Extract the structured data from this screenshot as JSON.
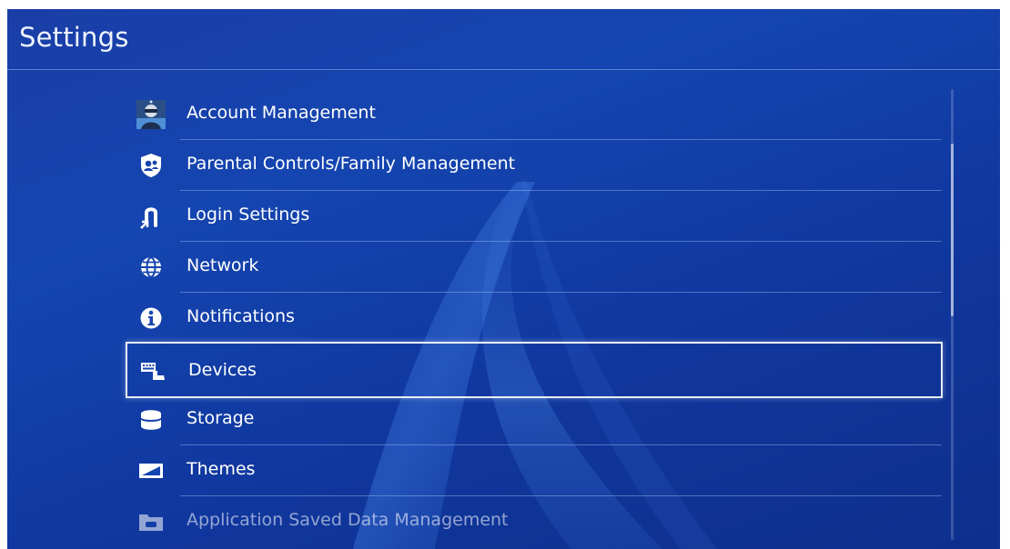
{
  "header": {
    "title": "Settings"
  },
  "menu": {
    "items": [
      {
        "label": "Account Management",
        "icon": "account-avatar-icon"
      },
      {
        "label": "Parental Controls/Family Management",
        "icon": "parental-controls-icon"
      },
      {
        "label": "Login Settings",
        "icon": "login-settings-icon"
      },
      {
        "label": "Network",
        "icon": "globe-icon"
      },
      {
        "label": "Notifications",
        "icon": "info-icon"
      },
      {
        "label": "Devices",
        "icon": "devices-icon"
      },
      {
        "label": "Storage",
        "icon": "storage-icon"
      },
      {
        "label": "Themes",
        "icon": "themes-icon"
      },
      {
        "label": "Application Saved Data Management",
        "icon": "saved-data-icon"
      }
    ],
    "selected_index": 5
  },
  "colors": {
    "background": "#1545b0",
    "text": "#ffffff",
    "divider": "#a0bef0"
  }
}
